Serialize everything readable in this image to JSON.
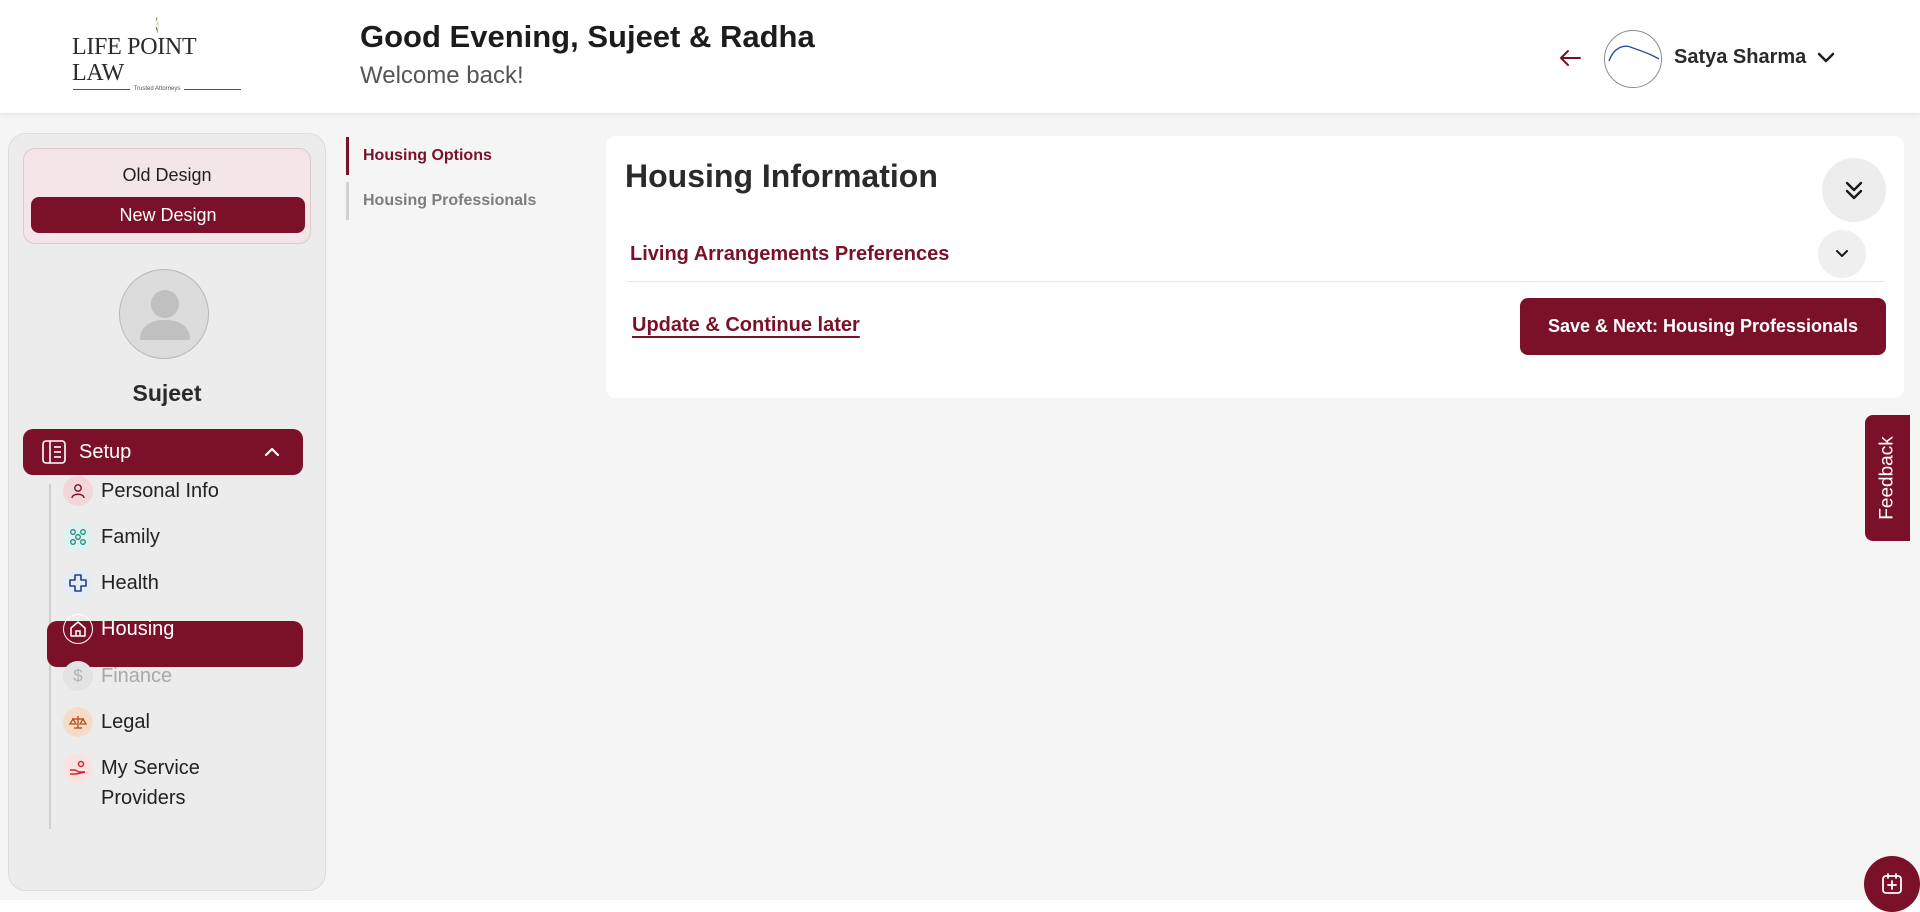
{
  "brand": {
    "name": "LIFE POINT LAW",
    "tagline": "Trusted Attorneys",
    "accent_color": "#7b1128"
  },
  "header": {
    "greeting": "Good Evening, Sujeet & Radha",
    "subtitle": "Welcome back!",
    "user_name": "Satya Sharma"
  },
  "sidebar": {
    "design_toggle": {
      "old_label": "Old Design",
      "new_label": "New Design"
    },
    "profile_name": "Sujeet",
    "setup_label": "Setup",
    "items": [
      {
        "label": "Personal Info",
        "icon": "person-icon"
      },
      {
        "label": "Family",
        "icon": "family-icon"
      },
      {
        "label": "Health",
        "icon": "health-cross-icon"
      },
      {
        "label": "Housing",
        "icon": "house-icon",
        "active": true
      },
      {
        "label": "Finance",
        "icon": "dollar-icon",
        "disabled": true
      },
      {
        "label": "Legal",
        "icon": "scales-icon"
      },
      {
        "label": "My Service Providers",
        "icon": "service-provider-icon"
      }
    ]
  },
  "subtabs": [
    {
      "label": "Housing Options",
      "active": true
    },
    {
      "label": "Housing Professionals"
    }
  ],
  "main": {
    "title": "Housing Information",
    "section_title": "Living Arrangements Preferences",
    "update_label": "Update & Continue later",
    "save_next_label": "Save & Next: Housing Professionals"
  },
  "feedback_label": "Feedback"
}
